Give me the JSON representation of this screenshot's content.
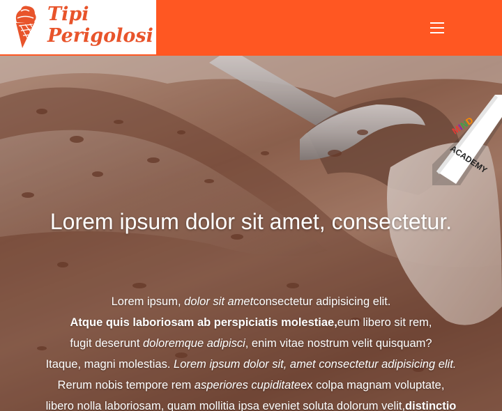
{
  "brand": {
    "line1": "Tipi",
    "line2": "Perigolosi",
    "color": "#e8542b"
  },
  "header": {
    "background": "#ff5722",
    "menu_icon": "hamburger-menu-icon"
  },
  "ribbon": {
    "line1": "MIND",
    "line2": "ACADEMY"
  },
  "hero": {
    "title": "Lorem ipsum dolor sit amet, consectetur.",
    "lines": [
      [
        {
          "t": "Lorem ipsum, ",
          "s": "n"
        },
        {
          "t": "dolor sit amet",
          "s": "i"
        },
        {
          "t": "consectetur adipisicing elit.",
          "s": "n"
        }
      ],
      [
        {
          "t": "Atque quis laboriosam ab perspiciatis molestiae,",
          "s": "b"
        },
        {
          "t": "eum libero sit rem,",
          "s": "n"
        }
      ],
      [
        {
          "t": "fugit deserunt ",
          "s": "n"
        },
        {
          "t": "doloremque adipisci",
          "s": "i"
        },
        {
          "t": ", enim vitae nostrum velit quisquam?",
          "s": "n"
        }
      ],
      [
        {
          "t": "Itaque, magni molestias. ",
          "s": "n"
        },
        {
          "t": "Lorem ipsum dolor sit, amet consectetur adipisicing elit.",
          "s": "i"
        }
      ],
      [
        {
          "t": "Rerum nobis tempore rem ",
          "s": "n"
        },
        {
          "t": "asperiores cupiditate",
          "s": "i"
        },
        {
          "t": "ex colpa magnam voluptate,",
          "s": "n"
        }
      ],
      [
        {
          "t": "libero nolla laboriosam, quam mollitia ipsa eveniet soluta dolorum velit,",
          "s": "n"
        },
        {
          "t": "distinctio",
          "s": "b"
        }
      ]
    ]
  }
}
